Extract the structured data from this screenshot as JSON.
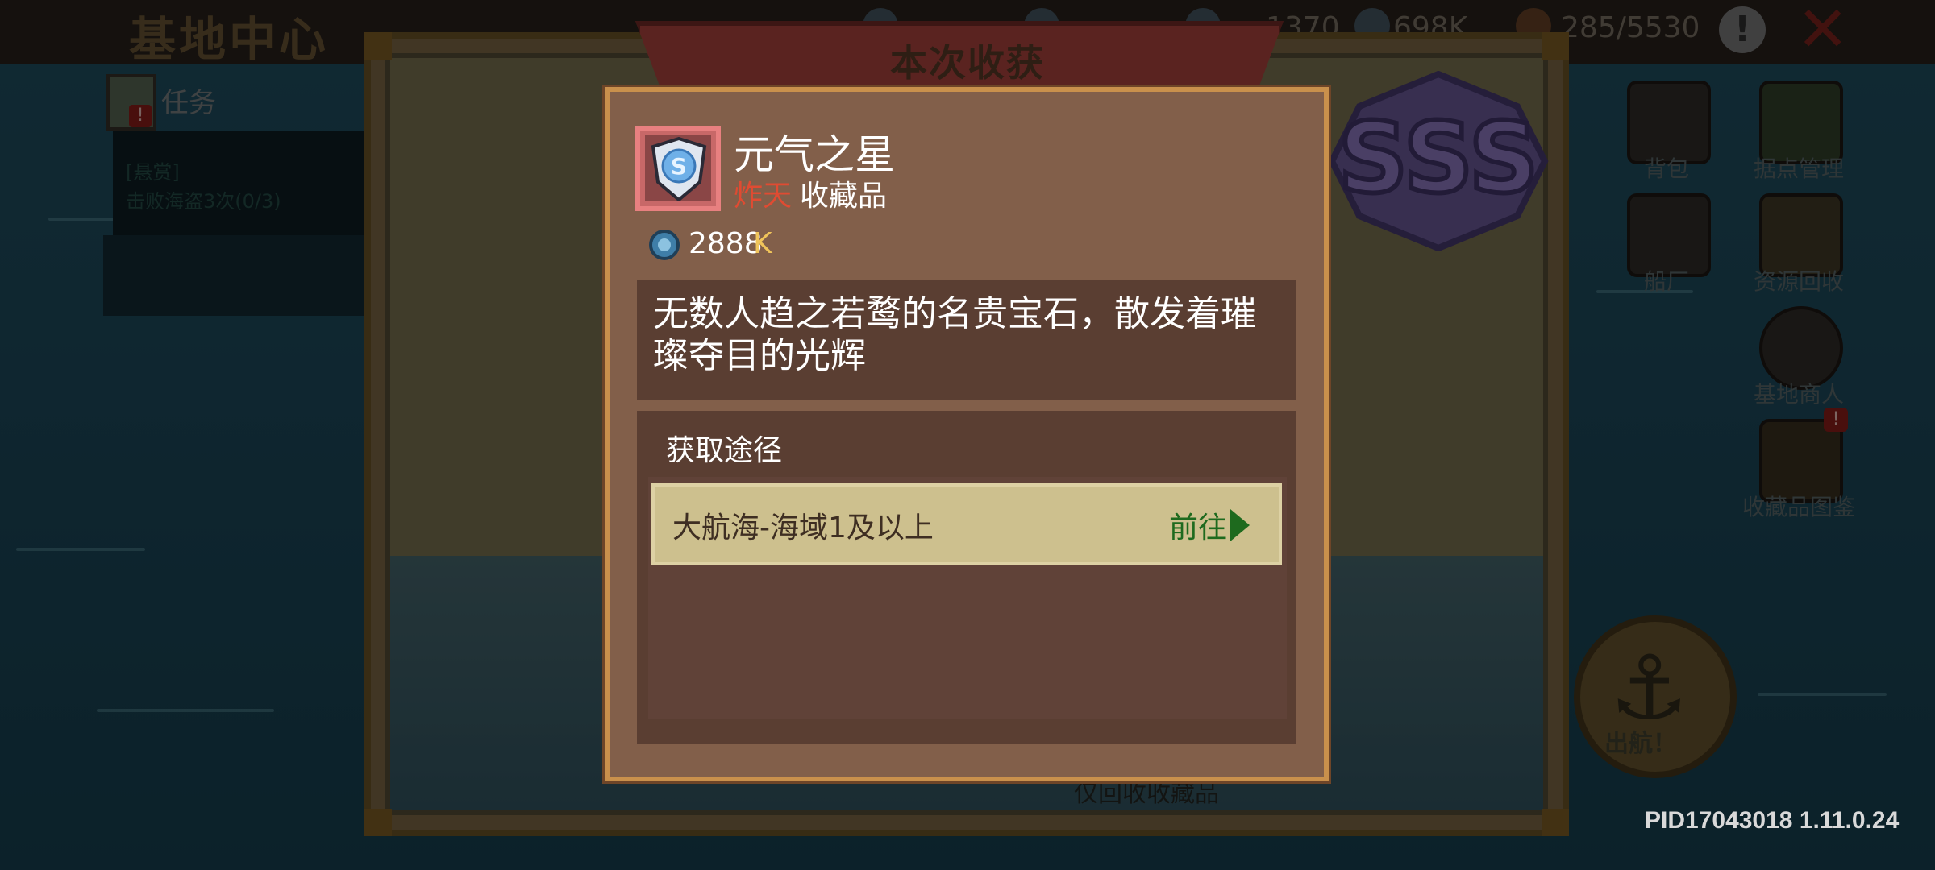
{
  "top_bar": {
    "title": "基地中心",
    "resource1": "1370",
    "resource2": "698K",
    "resource3": "285/5530"
  },
  "task_panel": {
    "title": "任务",
    "badge": "!",
    "tag": "[悬赏]",
    "line": "击败海盗3次(0/3)"
  },
  "right_menu": [
    {
      "label": "背包"
    },
    {
      "label": "据点管理"
    },
    {
      "label": "船厂"
    },
    {
      "label": "资源回收"
    },
    {
      "label": "基地商人"
    },
    {
      "label": "收藏品图鉴"
    }
  ],
  "sail_button": {
    "label": "出航！"
  },
  "collection_window": {
    "ribbon_title": "本次收获",
    "only_collections_label": "仅回收收藏品",
    "grade_badge": "SSS"
  },
  "item_detail": {
    "name": "元气之星",
    "rarity": "炸天",
    "type": "收藏品",
    "price_value": "2888",
    "price_unit": "K",
    "description": "无数人趋之若鹜的名贵宝石，散发着璀璨夺目的光辉",
    "source_title": "获取途径",
    "routes": [
      {
        "text": "大航海-海域1及以上",
        "action": "前往"
      }
    ]
  },
  "build_info": "PID17043018 1.11.0.24",
  "colors": {
    "rarity_red": "#e04b32",
    "price_gold": "#f0c45a",
    "go_green": "#1e6a1e",
    "modal_border": "#c9904c"
  }
}
